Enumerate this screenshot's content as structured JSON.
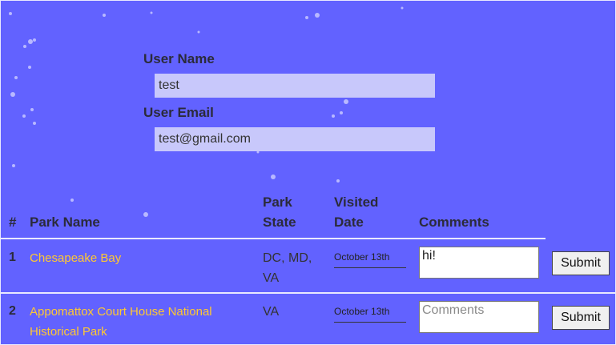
{
  "form": {
    "user_name_label": "User Name",
    "user_name_value": "test",
    "user_email_label": "User Email",
    "user_email_value": "test@gmail.com"
  },
  "table": {
    "headers": {
      "number": "#",
      "park_name": "Park Name",
      "park_state_line1": "Park",
      "park_state_line2": "State",
      "visited_date_line1": "Visited",
      "visited_date_line2": "Date",
      "comments": "Comments"
    },
    "rows": [
      {
        "number": "1",
        "park_name": "Chesapeake Bay",
        "state_line1": "DC, MD,",
        "state_line2": "VA",
        "date": "October 13th",
        "comment_value": "hi!",
        "comment_placeholder": "Comments",
        "submit_label": "Submit"
      },
      {
        "number": "2",
        "park_name_line1": "Appomattox Court House National",
        "park_name_line2": "Historical Park",
        "state_line1": "VA",
        "date": "October 13th",
        "comment_value": "",
        "comment_placeholder": "Comments",
        "submit_label": "Submit"
      }
    ]
  },
  "colors": {
    "background": "#6262ff",
    "link": "#ffc831",
    "input_background": "#c8c8fb"
  }
}
